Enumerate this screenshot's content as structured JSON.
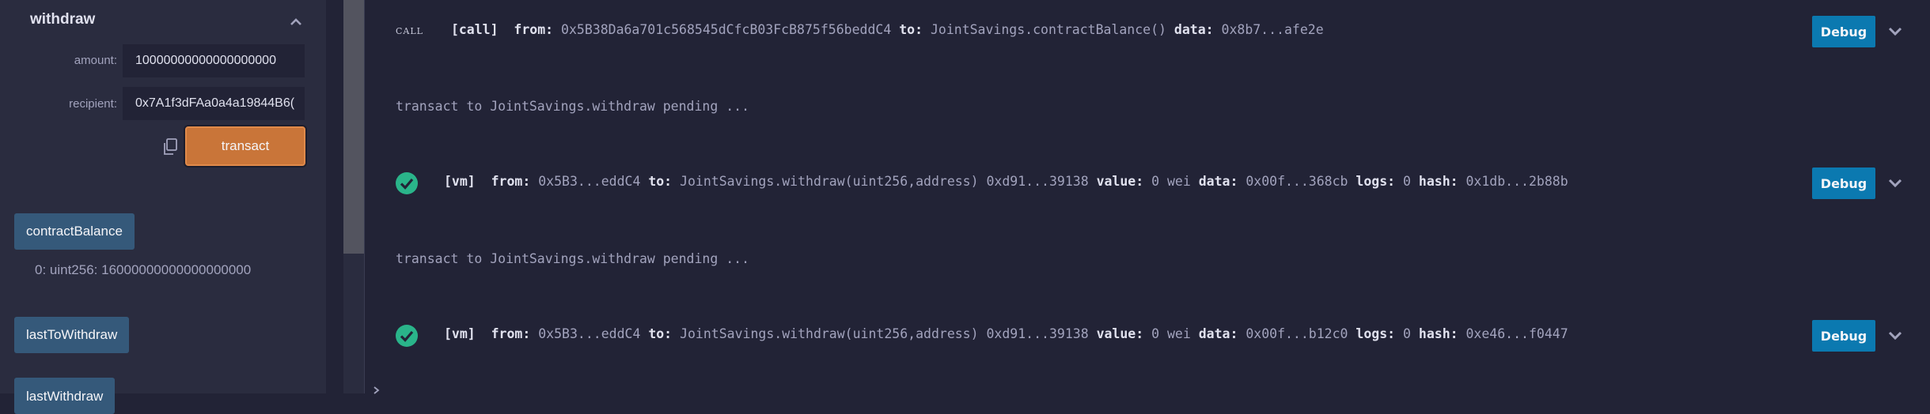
{
  "function_panel": {
    "title": "withdraw",
    "args": [
      {
        "label": "amount:",
        "value": "10000000000000000000"
      },
      {
        "label": "recipient:",
        "value": "0x7A1f3dFAa0a4a19844B6("
      }
    ],
    "transact_label": "transact",
    "calls": [
      {
        "label": "contractBalance",
        "result": "0: uint256: 16000000000000000000"
      },
      {
        "label": "lastToWithdraw"
      },
      {
        "label": "lastWithdraw"
      }
    ]
  },
  "terminal": {
    "entries": [
      {
        "kind": "call",
        "tag_text": "CALL",
        "tag": "[call]",
        "from": "0x5B38Da6a701c568545dCfcB03FcB875f56beddC4",
        "to": "JointSavings.contractBalance()",
        "data": "0x8b7...afe2e",
        "debug_label": "Debug"
      },
      {
        "kind": "pending",
        "text": "transact to JointSavings.withdraw pending ..."
      },
      {
        "kind": "vm",
        "tag": "[vm]",
        "from": "0x5B3...eddC4",
        "to": "JointSavings.withdraw(uint256,address) 0xd91...39138",
        "value": "0 wei",
        "data": "0x00f...368cb",
        "logs": "0",
        "hash": "0x1db...2b88b",
        "debug_label": "Debug"
      },
      {
        "kind": "pending",
        "text": "transact to JointSavings.withdraw pending ..."
      },
      {
        "kind": "vm",
        "tag": "[vm]",
        "from": "0x5B3...eddC4",
        "to": "JointSavings.withdraw(uint256,address) 0xd91...39138",
        "value": "0 wei",
        "data": "0x00f...b12c0",
        "logs": "0",
        "hash": "0xe46...f0447",
        "debug_label": "Debug"
      }
    ],
    "keys": {
      "from": "from:",
      "to": "to:",
      "data": "data:",
      "value": "value:",
      "logs": "logs:",
      "hash": "hash:"
    }
  },
  "colors": {
    "background": "#222336",
    "panel": "#2a2c3f",
    "transact": "#c97539",
    "call_button": "#35597a",
    "debug_button": "#0b79b0",
    "success": "#2ab48a"
  },
  "icons": [
    "chevron-up-icon",
    "copy-icon",
    "check-circle-icon",
    "chevron-down-icon"
  ]
}
